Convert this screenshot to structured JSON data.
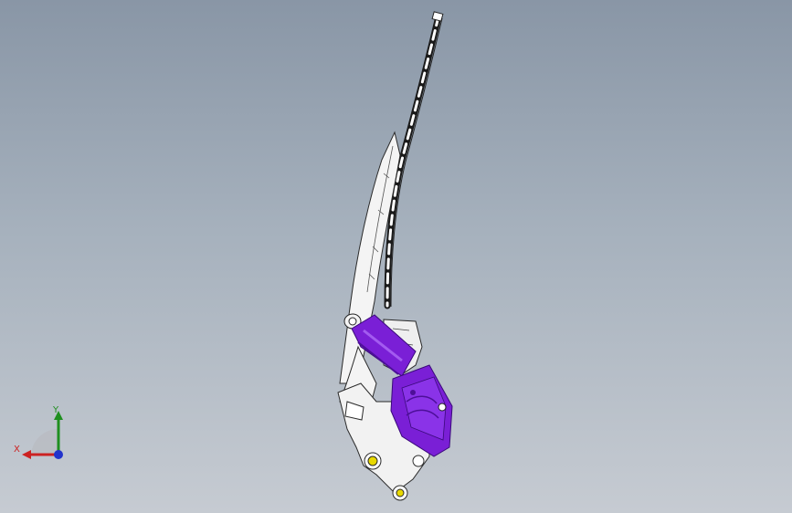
{
  "viewport": {
    "background_top": "#8996a6",
    "background_bottom": "#c6cbd2"
  },
  "model": {
    "description_icon": "wiper-arm-motor-assembly",
    "body_color": "#ffffff",
    "motor_color": "#7a1fd6",
    "motor_shadow_color": "#4d0f99",
    "fastener_color": "#e8d800"
  },
  "triad": {
    "x_label": "X",
    "y_label": "Y",
    "x_color": "#cc2222",
    "y_color": "#1f8f1f",
    "z_color": "#2233cc"
  }
}
